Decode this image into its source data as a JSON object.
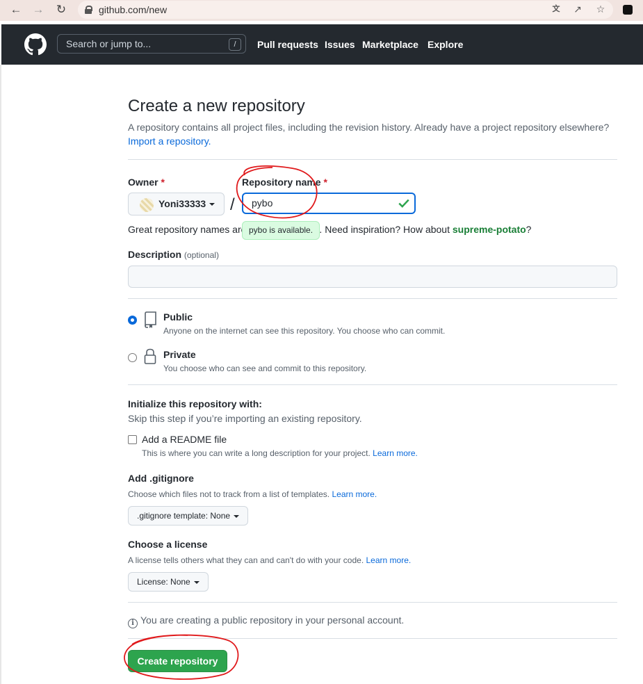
{
  "browser": {
    "url": "github.com/new"
  },
  "header": {
    "search_placeholder": "Search or jump to...",
    "search_shortcut": "/",
    "nav": [
      "Pull requests",
      "Issues",
      "Marketplace",
      "Explore"
    ]
  },
  "form": {
    "title": "Create a new repository",
    "subtitle": "A repository contains all project files, including the revision history. Already have a project repository elsewhere?",
    "import_link": "Import a repository.",
    "owner_label": "Owner",
    "required_mark": "*",
    "owner_value": "Yoni33333",
    "separator": "/",
    "repo_label": "Repository name",
    "repo_value": "pybo",
    "tooltip": "pybo is available.",
    "hint_start": "Great repository names are",
    "hint_mid": "rable. Need inspiration? How about ",
    "hint_suggestion": "supreme-potato",
    "hint_end": "?",
    "description_label": "Description",
    "description_optional": "(optional)",
    "description_value": "",
    "visibility": [
      {
        "title": "Public",
        "desc": "Anyone on the internet can see this repository. You choose who can commit.",
        "selected": true
      },
      {
        "title": "Private",
        "desc": "You choose who can see and commit to this repository.",
        "selected": false
      }
    ],
    "init_title": "Initialize this repository with:",
    "init_desc": "Skip this step if you’re importing an existing repository.",
    "readme_label": "Add a README file",
    "readme_desc": "This is where you can write a long description for your project.",
    "learn_more": "Learn more.",
    "gitignore_title": "Add .gitignore",
    "gitignore_desc": "Choose which files not to track from a list of templates.",
    "gitignore_select": ".gitignore template: None",
    "license_title": "Choose a license",
    "license_desc": "A license tells others what they can and can't do with your code.",
    "license_select": "License: None",
    "info_text": "You are creating a public repository in your personal account.",
    "info_glyph": "i",
    "submit_label": "Create repository"
  },
  "colors": {
    "header_bg": "#24292f",
    "link": "#0969da",
    "primary_button": "#2da44e",
    "annotation": "#e0191b"
  }
}
